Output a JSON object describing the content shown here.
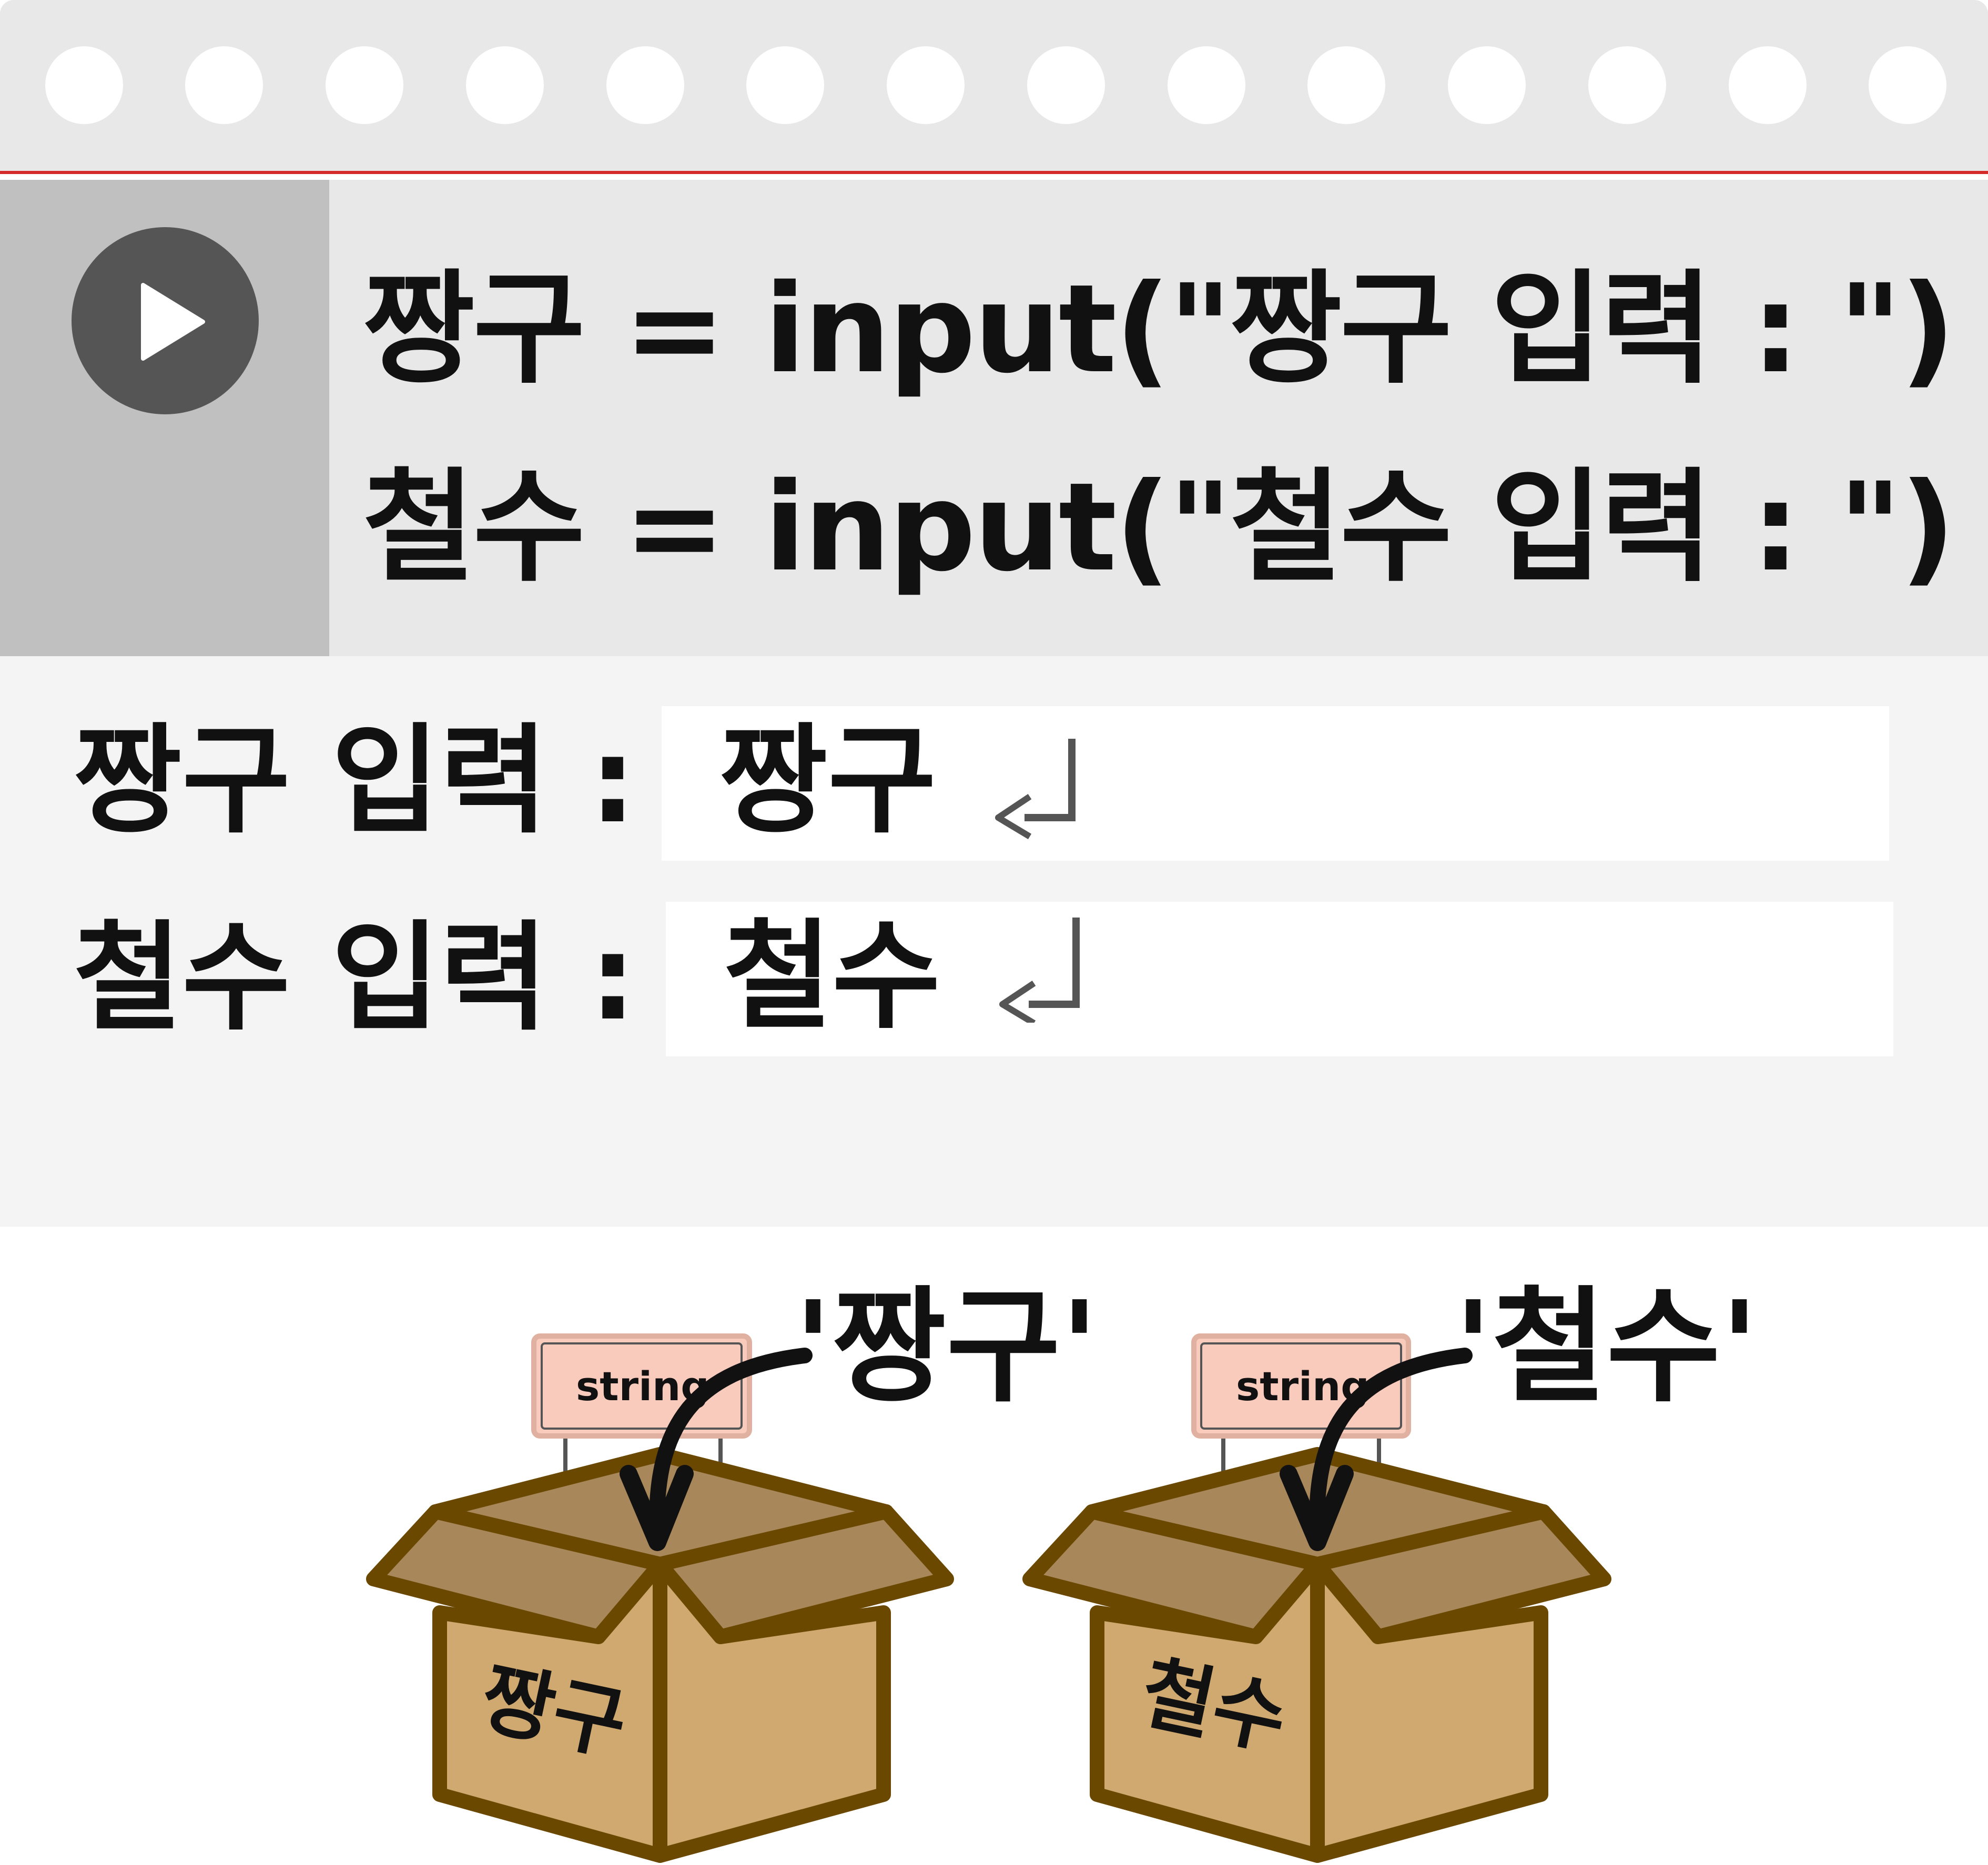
{
  "code": {
    "line1": "짱구 = input(\"짱구 입력 : \")",
    "line2": "철수 = input(\"철수 입력 : \")"
  },
  "output": {
    "rows": [
      {
        "prompt": "짱구 입력 :",
        "value": "짱구"
      },
      {
        "prompt": "철수 입력 :",
        "value": "철수"
      }
    ]
  },
  "diagram": {
    "boxes": [
      {
        "label": "짱구",
        "type_tag": "string",
        "assigned_value": "'짱구'"
      },
      {
        "label": "철수",
        "type_tag": "string",
        "assigned_value": "'철수'"
      }
    ]
  },
  "colors": {
    "notebook_header": "#e8e8e8",
    "margin_line": "#d42a2a",
    "gutter": "#c0c0c0",
    "play_button": "#555555",
    "output_background": "#f4f4f4",
    "box_front": "#cfa96f",
    "box_flap": "#a8885a",
    "box_outline": "#6b4800",
    "tag_fill": "#f9cbbd"
  },
  "icons": [
    "play-icon",
    "enter-return-icon",
    "curved-arrow-icon"
  ]
}
